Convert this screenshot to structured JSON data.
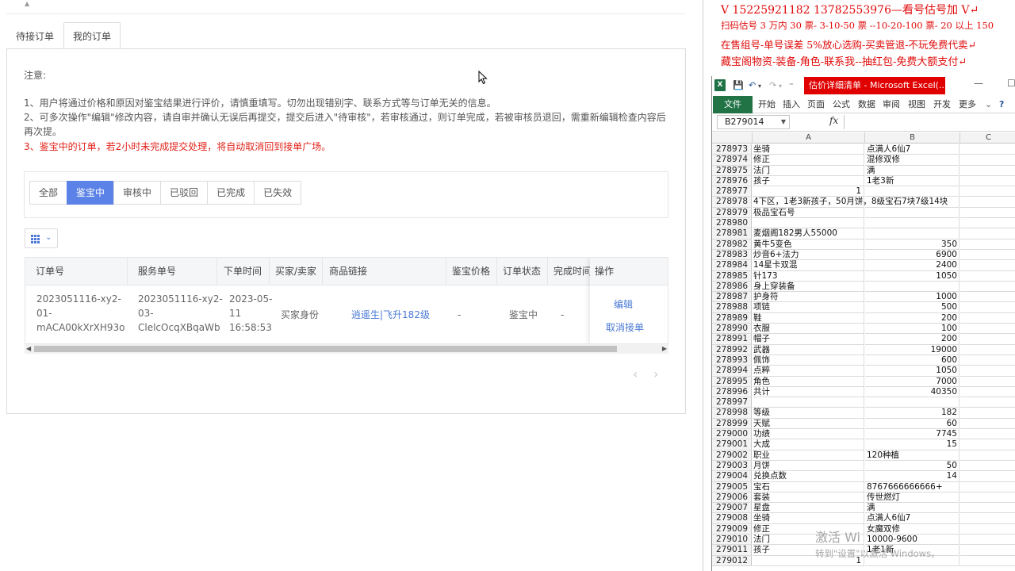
{
  "left": {
    "tabs": [
      "待接订单",
      "我的订单"
    ],
    "notes": {
      "title": "注意:",
      "line1": "1、用户将通过价格和原因对鉴宝结果进行评价，请慎重填写。切勿出现错别字、联系方式等与订单无关的信息。",
      "line2": "2、可多次操作\"编辑\"修改内容，请自审并确认无误后再提交，提交后进入\"待审核\"，若审核通过，则订单完成，若被审核员退回，需重新编辑检查内容后再次提。",
      "line3": "3、鉴宝中的订单，若2小时未完成提交处理，将自动取消回到接单广场。"
    },
    "filters": [
      "全部",
      "鉴宝中",
      "审核中",
      "已驳回",
      "已完成",
      "已失效"
    ],
    "active_filter": "鉴宝中",
    "table": {
      "headers": [
        "订单号",
        "服务单号",
        "下单时间",
        "买家/卖家",
        "商品链接",
        "鉴宝价格",
        "订单状态",
        "完成时间",
        "操作"
      ],
      "row": {
        "order_no": [
          "2023051116-xy2-",
          "01-",
          "mACA00kXrXH93o"
        ],
        "service_no": [
          "2023051116-xy2-",
          "03-",
          "ClelcOcqXBqaWb"
        ],
        "order_time": [
          "2023-05-",
          "11",
          "16:58:53"
        ],
        "buyer_seller": "买家身份",
        "product_link": "逍遥生|飞升182级",
        "price": "-",
        "status": "鉴宝中",
        "finish_time": "-",
        "actions": [
          "编辑",
          "取消接单"
        ]
      }
    },
    "pager": [
      "‹",
      "›"
    ]
  },
  "overlay": {
    "line1": "V 15225921182     13782553976—看号估号加 V↵",
    "line2": "扫码估号 3 万内 30 票- 3-10-50 票  --10-20-100 票-  20 以上 150",
    "line3": "在售组号-单号误差 5%放心选购-买卖管退-不玩免费代卖↵",
    "line4": "藏宝阁物资-装备-角色-联系我--抽红包-免费大额支付↵"
  },
  "excel": {
    "title": "估价详细清单 - Microsoft Excel(...",
    "ribbon_tabs": [
      "文件",
      "开始",
      "插入",
      "页面",
      "公式",
      "数据",
      "审阅",
      "视图",
      "开发",
      "更多"
    ],
    "name_box": "B279014",
    "fx": "fx",
    "columns": [
      "A",
      "B",
      "C"
    ],
    "rows": [
      {
        "n": "278973",
        "a": "坐骑",
        "b": "点满人6仙7"
      },
      {
        "n": "278974",
        "a": "修正",
        "b": "混修双修"
      },
      {
        "n": "278975",
        "a": "法门",
        "b": "满"
      },
      {
        "n": "278976",
        "a": "孩子",
        "b": "1老3新"
      },
      {
        "n": "278977",
        "a": "1",
        "b": "",
        "anum": true
      },
      {
        "n": "278978",
        "a": "4下区，1老3新孩子，50月饼，8级宝石7块7级14块",
        "b": ""
      },
      {
        "n": "278979",
        "a": "极品宝石号",
        "b": ""
      },
      {
        "n": "278980",
        "a": "",
        "b": ""
      },
      {
        "n": "278981",
        "a": "麦烟阁182男人55000",
        "b": ""
      },
      {
        "n": "278982",
        "a": "黄牛5变色",
        "b": "350",
        "num": true
      },
      {
        "n": "278983",
        "a": "炒音6+法力",
        "b": "6900",
        "num": true
      },
      {
        "n": "278984",
        "a": "14星卡双混",
        "b": "2400",
        "num": true
      },
      {
        "n": "278985",
        "a": "针173",
        "b": "1050",
        "num": true
      },
      {
        "n": "278986",
        "a": "身上穿装备",
        "b": ""
      },
      {
        "n": "278987",
        "a": "护身符",
        "b": "1000",
        "num": true
      },
      {
        "n": "278988",
        "a": "项链",
        "b": "500",
        "num": true
      },
      {
        "n": "278989",
        "a": "鞋",
        "b": "200",
        "num": true
      },
      {
        "n": "278990",
        "a": "衣服",
        "b": "100",
        "num": true
      },
      {
        "n": "278991",
        "a": "帽子",
        "b": "200",
        "num": true
      },
      {
        "n": "278992",
        "a": "武器",
        "b": "19000",
        "num": true
      },
      {
        "n": "278993",
        "a": "佩饰",
        "b": "600",
        "num": true
      },
      {
        "n": "278994",
        "a": "点粹",
        "b": "1050",
        "num": true
      },
      {
        "n": "278995",
        "a": "角色",
        "b": "7000",
        "num": true
      },
      {
        "n": "278996",
        "a": "共计",
        "b": "40350",
        "num": true
      },
      {
        "n": "278997",
        "a": "",
        "b": ""
      },
      {
        "n": "278998",
        "a": "等级",
        "b": "182",
        "num": true
      },
      {
        "n": "278999",
        "a": "天赋",
        "b": "60",
        "num": true
      },
      {
        "n": "279000",
        "a": "功绩",
        "b": "7745",
        "num": true
      },
      {
        "n": "279001",
        "a": "大成",
        "b": "15",
        "num": true
      },
      {
        "n": "279002",
        "a": "职业",
        "b": "120种植"
      },
      {
        "n": "279003",
        "a": "月饼",
        "b": "50",
        "num": true
      },
      {
        "n": "279004",
        "a": "兑换点数",
        "b": "14",
        "num": true
      },
      {
        "n": "279005",
        "a": "宝石",
        "b": "8767666666666+"
      },
      {
        "n": "279006",
        "a": "套装",
        "b": "传世燃灯"
      },
      {
        "n": "279007",
        "a": "星盘",
        "b": "满"
      },
      {
        "n": "279008",
        "a": "坐骑",
        "b": "点满人6仙7"
      },
      {
        "n": "279009",
        "a": "修正",
        "b": "女魔双修"
      },
      {
        "n": "279010",
        "a": "法门",
        "b": "10000-9600"
      },
      {
        "n": "279011",
        "a": "孩子",
        "b": "1老1新"
      },
      {
        "n": "279012",
        "a": "1",
        "b": "",
        "anum": true
      }
    ]
  },
  "watermark": {
    "line1": "激活 Wi",
    "line2": "转到\"设置\"以激活 Windows。"
  }
}
